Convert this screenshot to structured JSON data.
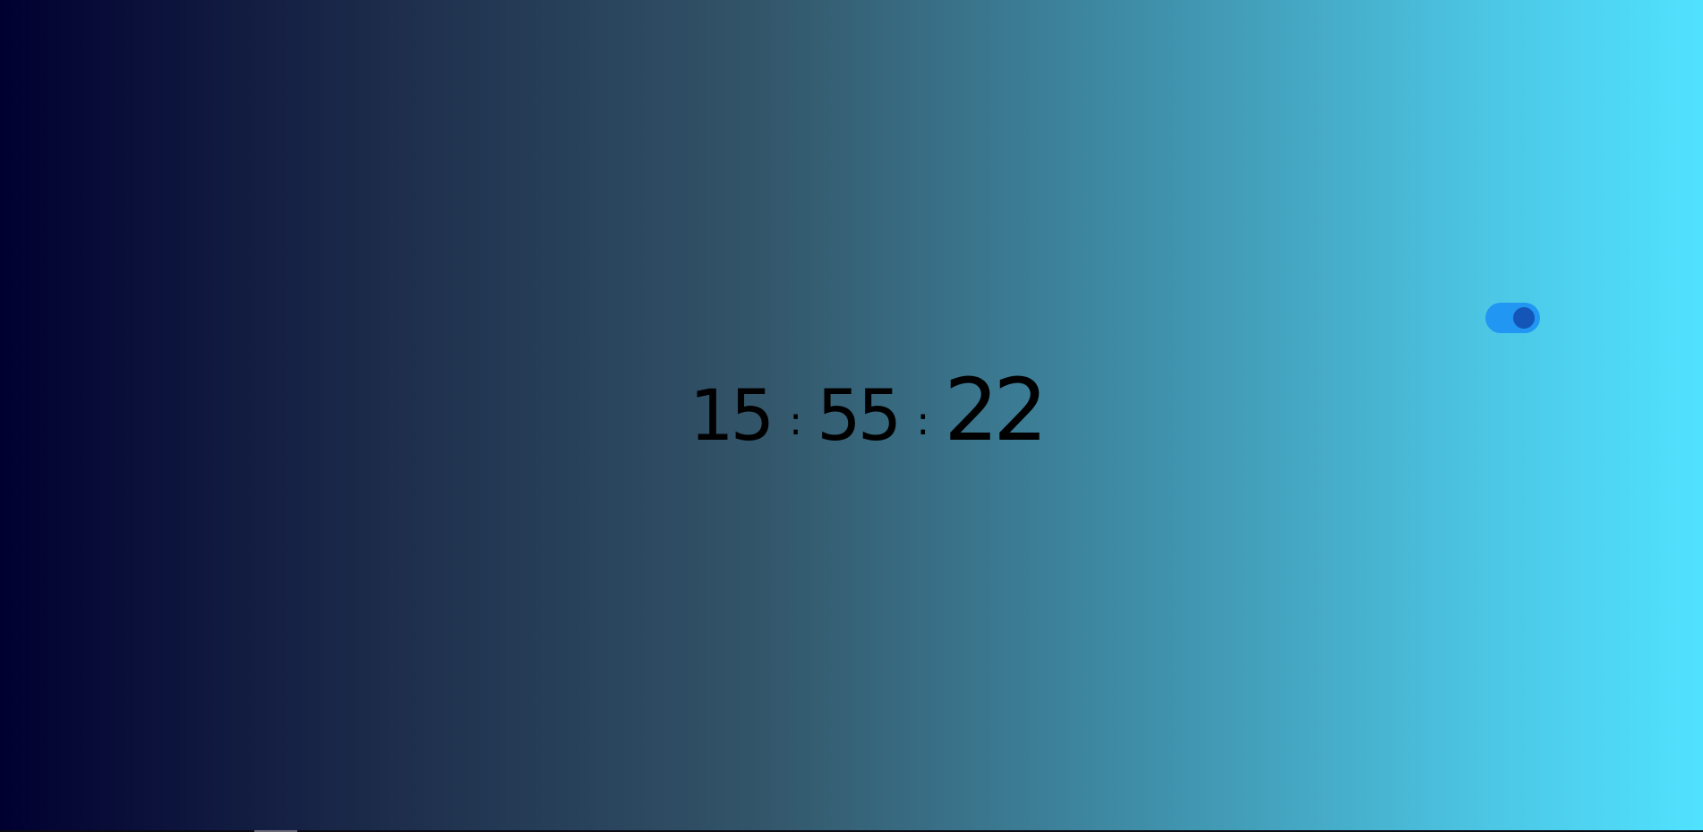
{
  "clock": {
    "hours": "15",
    "minutes": "55",
    "seconds": "22",
    "separator": ":"
  },
  "toggle": {
    "state": "on",
    "track_color": "#2196f3",
    "knob_color": "#1456b8"
  },
  "background": {
    "gradient_start": "#000030",
    "gradient_end": "#50e2ff"
  }
}
